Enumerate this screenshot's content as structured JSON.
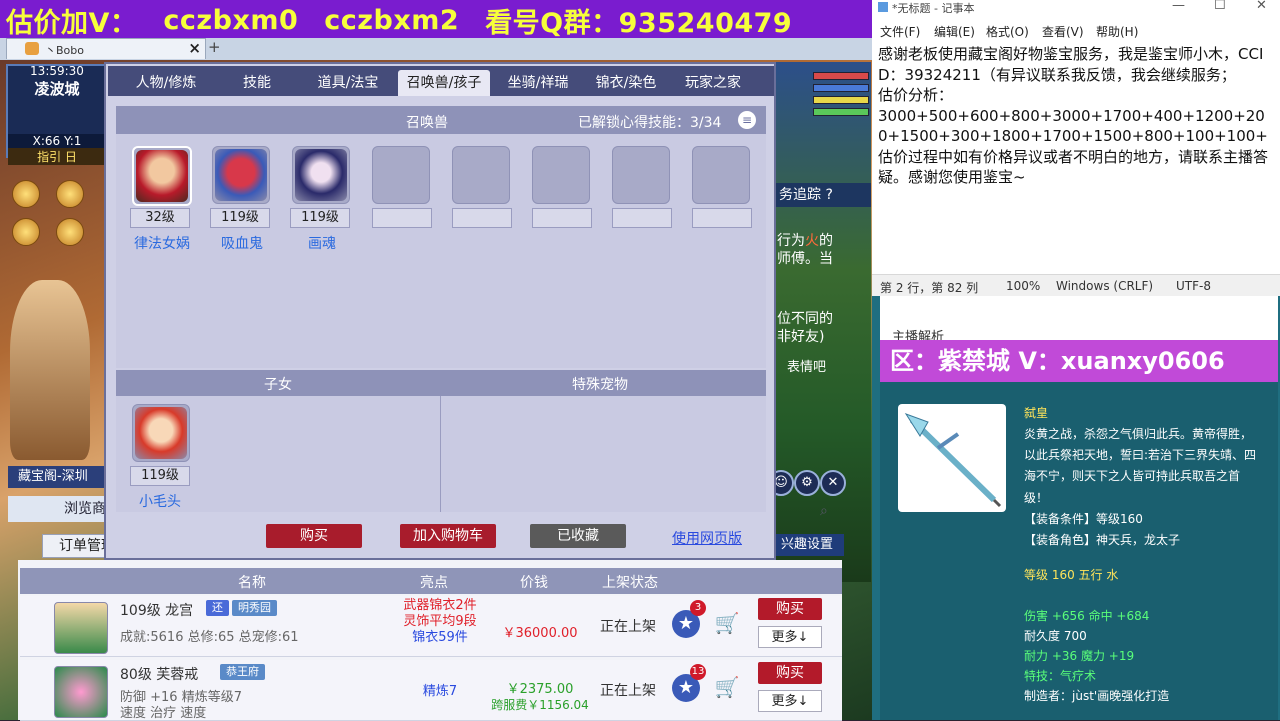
{
  "banner": {
    "items": [
      "估价加V：",
      "cczbxm0",
      "cczbxm2",
      "看号Q群：935240479"
    ]
  },
  "browser": {
    "tab_title": "丶Bobo",
    "tab_close": "×",
    "new_tab": "+"
  },
  "game": {
    "clock": "13:59:30",
    "city": "凌波城",
    "coords": "X:66 Y:1",
    "guide": "指引  日",
    "left_panel_label": "藏宝阁-深圳",
    "browse_label": "浏览商",
    "order_label": "订单管理",
    "interest_label": "兴趣设置",
    "mission_track": "务追踪 ?",
    "mission_text_a": "行为",
    "mission_text_fire": "火",
    "mission_text_b": "的",
    "mission_text_c": "师傅。当",
    "chat_text_a": "位不同的",
    "chat_text_b": "非好友)",
    "emote": "表情吧",
    "market_icons": [
      "☺",
      "⚙",
      "✕"
    ]
  },
  "dialog": {
    "tabs": [
      "人物/修炼",
      "技能",
      "道具/法宝",
      "召唤兽/孩子",
      "坐骑/祥瑞",
      "锦衣/染色",
      "玩家之家"
    ],
    "active_tab": 3,
    "pet_header": "召唤兽",
    "unlocked_skills_label": "已解锁心得技能：",
    "unlocked_skills_value": "3/34",
    "pets": [
      {
        "level": "32级",
        "name": "律法女娲"
      },
      {
        "level": "119级",
        "name": "吸血鬼"
      },
      {
        "level": "119级",
        "name": "画魂"
      }
    ],
    "children_header": "子女",
    "special_header": "特殊宠物",
    "child": {
      "level": "119级",
      "name": "小毛头"
    },
    "buttons": {
      "buy": "购买",
      "add_cart": "加入购物车",
      "collected": "已收藏",
      "web": "使用网页版"
    }
  },
  "market": {
    "columns": [
      "名称",
      "亮点",
      "价钱",
      "上架状态"
    ],
    "rows": [
      {
        "level_school": "109级  龙宫",
        "badge1": "还",
        "badge2": "明秀园",
        "sub": "成就:5616  总修:65  总宠修:61",
        "highlights": [
          "武器锦衣2件",
          "灵饰平均9段",
          "锦衣59件"
        ],
        "price": "￥36000.00",
        "price2": "",
        "status": "正在上架",
        "star_count": "3",
        "buy": "购买",
        "more": "更多↓"
      },
      {
        "level_school": "80级  芙蓉戒",
        "badge1": "",
        "badge2": "恭王府",
        "sub": "防御 +16  精炼等级7",
        "highlights": [
          "精炼7"
        ],
        "price": "￥2375.00",
        "price2": "跨服费￥1156.04",
        "status": "正在上架",
        "star_count": "13",
        "buy": "购买",
        "more": "更多↓"
      }
    ],
    "row2_extra": "速度  治疗  速度"
  },
  "notepad": {
    "title": "*无标题 - 记事本",
    "controls": [
      "—",
      "☐",
      "✕"
    ],
    "menu": [
      "文件(F)",
      "编辑(E)",
      "格式(O)",
      "查看(V)",
      "帮助(H)"
    ],
    "text": "感谢老板使用藏宝阁好物鉴宝​服务，我是鉴宝师小木，CCID：39324211（有异议联系我反馈，我会继续服务；\n估价分析：\n3000+500+600+800+3000+1700+400+1200+200+1500+300+1800+1700+1500+800+100+100+\n估价过程中如有价格异议或者不明白的地方，请联系主播答疑。感谢您使用鉴宝~",
    "status": {
      "position": "第 2 行，第 82 列",
      "zoom": "100%",
      "eol": "Windows (CRLF)",
      "encoding": "UTF-8"
    }
  },
  "right_panel": {
    "analysis_label": "主播解析",
    "banner": "区：紫禁城  V：xuanxy0606",
    "weapon_name": "弑皇",
    "weapon_desc": "炎黄之战，杀怨之气俱归此兵。黄帝得胜，以此兵祭祀天地，誓曰:若治下三界失靖、四海不宁，则天下之人皆可持此兵取吾之首级！",
    "req_level": "【装备条件】等级160",
    "req_role": "【装备角色】神天兵，龙太子",
    "level_line": "等级 160  五行 水",
    "stats": [
      {
        "text": "伤害 +656  命中 +684",
        "cls": "g"
      },
      {
        "text": "耐久度 700",
        "cls": "w"
      },
      {
        "text": "耐力 +36  魔力 +19",
        "cls": "g"
      },
      {
        "text": "特技：气疗术",
        "cls": "g"
      },
      {
        "text": "制造者：jùst'画晚强化打造",
        "cls": "w"
      }
    ]
  },
  "colors": {
    "banner_bg": "#7a1ccf",
    "banner_text": "#f7ff3a",
    "buy_red": "#b31a2a",
    "link_blue": "#2a4adf",
    "panel_teal": "#1a5f6f"
  }
}
